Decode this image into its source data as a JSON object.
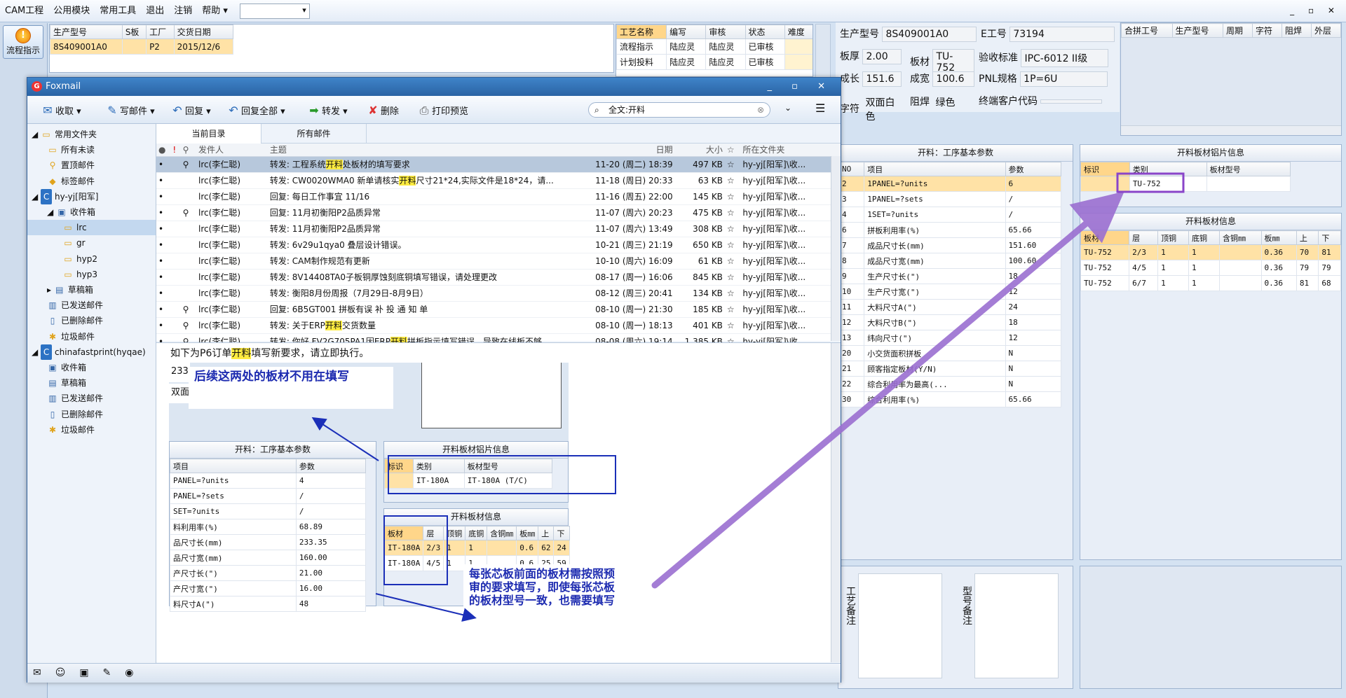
{
  "menubar": {
    "items": [
      "CAM工程",
      "公用模块",
      "常用工具",
      "退出",
      "注销",
      "帮助"
    ]
  },
  "left": {
    "flow_btn": "流程指示"
  },
  "topgrid": {
    "headers": [
      "生产型号",
      "S板",
      "工厂",
      "交货日期"
    ],
    "row": [
      "8S409001A0",
      "",
      "P2",
      "2015/12/6"
    ]
  },
  "procgrid": {
    "headers": [
      "工艺名称",
      "编写",
      "审核",
      "状态",
      "难度"
    ],
    "rows": [
      [
        "流程指示",
        "陆应灵",
        "陆应灵",
        "已审核",
        ""
      ],
      [
        "计划投料",
        "陆应灵",
        "陆应灵",
        "已审核",
        ""
      ]
    ]
  },
  "info": {
    "lbl_model": "生产型号",
    "val_model": "8S409001A0",
    "lbl_e": "E工号",
    "val_e": "73194",
    "lbl_thick": "板厚",
    "val_thick": "2.00",
    "lbl_mat": "板材",
    "val_mat": "TU-752",
    "lbl_std": "验收标准",
    "val_std": "IPC-6012 II级",
    "lbl_len": "成长",
    "val_len": "151.6",
    "lbl_wid": "成宽",
    "val_wid": "100.6",
    "lbl_pnl": "PNL规格",
    "val_pnl": "1P=6U",
    "lbl_char": "字符",
    "val_char": "双面白色",
    "lbl_mask": "阻焊",
    "val_mask": "绿色",
    "lbl_cust": "终端客户代码"
  },
  "mergegrid": {
    "headers": [
      "合拼工号",
      "生产型号",
      "周期",
      "字符",
      "阻焊",
      "外层"
    ]
  },
  "params": {
    "title": "开料：工序基本参数",
    "headers": [
      "NO",
      "项目",
      "参数"
    ],
    "rows": [
      [
        "2",
        "1PANEL=?units",
        "6"
      ],
      [
        "3",
        "1PANEL=?sets",
        "/"
      ],
      [
        "4",
        "1SET=?units",
        "/"
      ],
      [
        "6",
        "拼板利用率(%)",
        "65.66"
      ],
      [
        "7",
        "成品尺寸长(mm)",
        "151.60"
      ],
      [
        "8",
        "成品尺寸宽(mm)",
        "100.60"
      ],
      [
        "9",
        "生产尺寸长(\")",
        "18"
      ],
      [
        "10",
        "生产尺寸宽(\")",
        "12"
      ],
      [
        "11",
        "大料尺寸A(\")",
        "24"
      ],
      [
        "12",
        "大料尺寸B(\")",
        "18"
      ],
      [
        "13",
        "纬向尺寸(\")",
        "12"
      ],
      [
        "20",
        "小交货面积拼板",
        "N"
      ],
      [
        "21",
        "顾客指定板材(Y/N)",
        "N"
      ],
      [
        "22",
        "综合利用率为最高(...",
        "N"
      ],
      [
        "30",
        "综合利用率(%)",
        "65.66"
      ]
    ]
  },
  "sheetinfo": {
    "title": "开料板材铝片信息",
    "headers": [
      "标识",
      "类别",
      "板材型号"
    ],
    "row": [
      "",
      "TU-752",
      ""
    ]
  },
  "boardinfo": {
    "title": "开料板材信息",
    "headers": [
      "板材",
      "层",
      "顶铜",
      "底铜",
      "含铜㎜",
      "板㎜",
      "上",
      "下"
    ],
    "rows": [
      [
        "TU-752",
        "2/3",
        "1",
        "1",
        "",
        "0.36",
        "70",
        "81"
      ],
      [
        "TU-752",
        "4/5",
        "1",
        "1",
        "",
        "0.36",
        "79",
        "79"
      ],
      [
        "TU-752",
        "6/7",
        "1",
        "1",
        "",
        "0.36",
        "81",
        "68"
      ]
    ]
  },
  "remarks": {
    "proc": "工艺备注",
    "model": "型号备注"
  },
  "foxmail": {
    "title": "Foxmail",
    "toolbar": {
      "receive": "收取",
      "compose": "写邮件",
      "reply": "回复",
      "reply_all": "回复全部",
      "forward": "转发",
      "delete": "删除",
      "print": "打印预览"
    },
    "search": "全文:开料",
    "folders": [
      {
        "label": "常用文件夹",
        "lvl": 0,
        "icon": "folder-icon"
      },
      {
        "label": "所有未读",
        "lvl": 1,
        "icon": "folder-icon"
      },
      {
        "label": "置顶邮件",
        "lvl": 1,
        "icon": "pin-icon"
      },
      {
        "label": "标签邮件",
        "lvl": 1,
        "icon": "tag-icon"
      },
      {
        "label": "hy-yj[阳军]",
        "lvl": 0,
        "icon": "account-icon"
      },
      {
        "label": "收件箱",
        "lvl": 1,
        "icon": "inbox-icon"
      },
      {
        "label": "lrc",
        "lvl": 2,
        "icon": "folder-icon",
        "sel": true
      },
      {
        "label": "gr",
        "lvl": 2,
        "icon": "folder-icon"
      },
      {
        "label": "hyp2",
        "lvl": 2,
        "icon": "folder-icon"
      },
      {
        "label": "hyp3",
        "lvl": 2,
        "icon": "folder-icon"
      },
      {
        "label": "草稿箱",
        "lvl": 1,
        "icon": "drafts-icon"
      },
      {
        "label": "已发送邮件",
        "lvl": 1,
        "icon": "sent-icon"
      },
      {
        "label": "已删除邮件",
        "lvl": 1,
        "icon": "trash-icon"
      },
      {
        "label": "垃圾邮件",
        "lvl": 1,
        "icon": "junk-icon"
      },
      {
        "label": "chinafastprint(hyqae)",
        "lvl": 0,
        "icon": "account-icon"
      },
      {
        "label": "收件箱",
        "lvl": 1,
        "icon": "inbox-icon"
      },
      {
        "label": "草稿箱",
        "lvl": 1,
        "icon": "drafts-icon"
      },
      {
        "label": "已发送邮件",
        "lvl": 1,
        "icon": "sent-icon"
      },
      {
        "label": "已删除邮件",
        "lvl": 1,
        "icon": "trash-icon"
      },
      {
        "label": "垃圾邮件",
        "lvl": 1,
        "icon": "junk-icon"
      }
    ],
    "tabs": [
      "当前目录",
      "所有邮件"
    ],
    "cols": [
      "发件人",
      "主题",
      "日期",
      "大小",
      "所在文件夹"
    ],
    "mails": [
      {
        "att": true,
        "from": "lrc(李仁聪)",
        "pre": "转发: 工程系统",
        "hl": "开料",
        "post": "处板材的填写要求",
        "date": "11-20 (周二) 18:39",
        "size": "497 KB",
        "folder": "hy-yj[阳军]\\收...",
        "sel": true
      },
      {
        "att": false,
        "from": "lrc(李仁聪)",
        "pre": "转发: CW0020WMA0  新单请核实",
        "hl": "开料",
        "post": "尺寸21*24,实际文件是18*24，请...",
        "date": "11-18 (周日) 20:33",
        "size": "63 KB",
        "folder": "hy-yj[阳军]\\收..."
      },
      {
        "att": false,
        "from": "lrc(李仁聪)",
        "pre": "回复: 每日工作事宜 11/16",
        "hl": "",
        "post": "",
        "date": "11-16 (周五) 22:00",
        "size": "145 KB",
        "folder": "hy-yj[阳军]\\收..."
      },
      {
        "att": true,
        "from": "lrc(李仁聪)",
        "pre": "回复: 11月初衡阳P2品质异常",
        "hl": "",
        "post": "",
        "date": "11-07 (周六) 20:23",
        "size": "475 KB",
        "folder": "hy-yj[阳军]\\收..."
      },
      {
        "att": false,
        "from": "lrc(李仁聪)",
        "pre": "转发: 11月初衡阳P2品质异常",
        "hl": "",
        "post": "",
        "date": "11-07 (周六) 13:49",
        "size": "308 KB",
        "folder": "hy-yj[阳军]\\收..."
      },
      {
        "att": false,
        "from": "lrc(李仁聪)",
        "pre": "转发: 6v29u1qya0  叠层设计错误。",
        "hl": "",
        "post": "",
        "date": "10-21 (周三) 21:19",
        "size": "650 KB",
        "folder": "hy-yj[阳军]\\收..."
      },
      {
        "att": false,
        "from": "lrc(李仁聪)",
        "pre": "转发: CAM制作规范有更新",
        "hl": "",
        "post": "",
        "date": "10-10 (周六) 16:09",
        "size": "61 KB",
        "folder": "hy-yj[阳军]\\收..."
      },
      {
        "att": false,
        "from": "lrc(李仁聪)",
        "pre": "转发: 8V14408TA0子板铜厚蚀刻底铜填写错误，请处理更改",
        "hl": "",
        "post": "",
        "date": "08-17 (周一) 16:06",
        "size": "845 KB",
        "folder": "hy-yj[阳军]\\收..."
      },
      {
        "att": false,
        "from": "lrc(李仁聪)",
        "pre": "转发: 衡阳8月份周报（7月29日-8月9日）",
        "hl": "",
        "post": "",
        "date": "08-12 (周三) 20:41",
        "size": "134 KB",
        "folder": "hy-yj[阳军]\\收..."
      },
      {
        "att": true,
        "from": "lrc(李仁聪)",
        "pre": "回复: 6B5GT001  拼板有误  补 投 通 知 单",
        "hl": "",
        "post": "",
        "date": "08-10 (周一) 21:30",
        "size": "185 KB",
        "folder": "hy-yj[阳军]\\收..."
      },
      {
        "att": true,
        "from": "lrc(李仁聪)",
        "pre": "转发: 关于ERP",
        "hl": "开料",
        "post": "交货数量",
        "date": "08-10 (周一) 18:13",
        "size": "401 KB",
        "folder": "hy-yj[阳军]\\收..."
      },
      {
        "att": true,
        "from": "lrc(李仁聪)",
        "pre": "转发: 你好   FV2G705PA1因ERP",
        "hl": "开料",
        "post": "拼板指示填写错误，导致在线板不够...",
        "date": "08-08 (周六) 19:14",
        "size": "1,385 KB",
        "folder": "hy-yj[阳军]\\收..."
      }
    ],
    "preview": {
      "pre": "如下为P6订单",
      "hl": "开料",
      "post": "填写新要求，请立即执行。",
      "frag1": "233.3",
      "frag2": "双面",
      "note1": "后续这两处的板材不用在填写",
      "note2": "每张芯板前面的板材需按照预审的要求填写，即使每张芯板的板材型号一致，也需要填写",
      "p_title": "开料：工序基本参数",
      "p_headers": [
        "项目",
        "参数"
      ],
      "p_rows": [
        [
          "PANEL=?units",
          "4"
        ],
        [
          "PANEL=?sets",
          "/"
        ],
        [
          "SET=?units",
          "/"
        ],
        [
          "料利用率(%)",
          "68.89"
        ],
        [
          "品尺寸长(mm)",
          "233.35"
        ],
        [
          "品尺寸宽(mm)",
          "160.00"
        ],
        [
          "产尺寸长(\")",
          "21.00"
        ],
        [
          "产尺寸宽(\")",
          "16.00"
        ],
        [
          "料尺寸A(\")",
          "48"
        ]
      ],
      "s_title": "开料板材铝片信息",
      "s_headers": [
        "标识",
        "类别",
        "板材型号"
      ],
      "s_row": [
        "",
        "IT-180A",
        "IT-180A (T/C)"
      ],
      "b_title": "开料板材信息",
      "b_headers": [
        "板材",
        "层",
        "顶铜",
        "底铜",
        "含铜㎜",
        "板㎜",
        "上",
        "下"
      ],
      "b_rows": [
        [
          "IT-180A",
          "2/3",
          "1",
          "1",
          "",
          "0.6",
          "62",
          "24"
        ],
        [
          "IT-180A",
          "4/5",
          "1",
          "1",
          "",
          "0.6",
          "25",
          "59"
        ]
      ],
      "frag3": "型"
    }
  }
}
